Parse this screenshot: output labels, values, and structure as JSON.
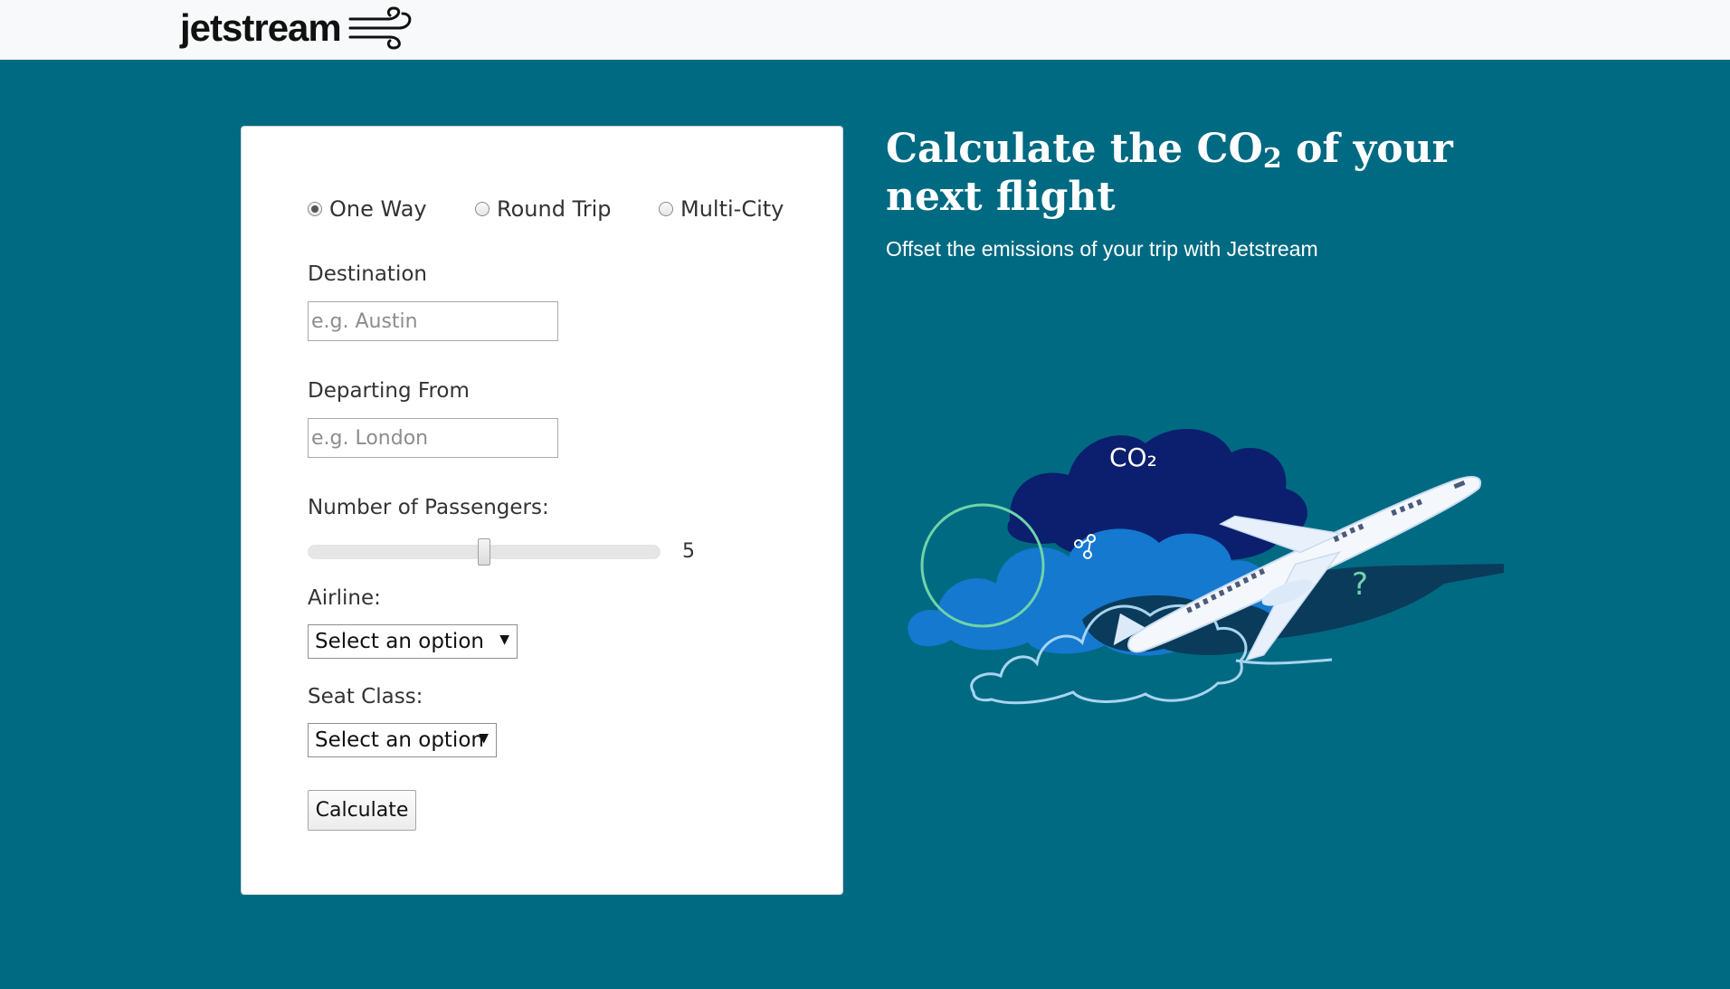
{
  "header": {
    "logo_text": "jetstream",
    "logo_icon": "wind-icon"
  },
  "form": {
    "trip_types": [
      {
        "label": "One Way",
        "checked": true
      },
      {
        "label": "Round Trip",
        "checked": false
      },
      {
        "label": "Multi-City",
        "checked": false
      }
    ],
    "destination": {
      "label": "Destination",
      "placeholder": "e.g. Austin",
      "value": ""
    },
    "departing": {
      "label": "Departing From",
      "placeholder": "e.g. London",
      "value": ""
    },
    "passengers": {
      "label": "Number of Passengers:",
      "value": "5",
      "min": 1,
      "max": 9
    },
    "airline": {
      "label": "Airline:",
      "selected": "Select an option"
    },
    "seat_class": {
      "label": "Seat Class:",
      "selected": "Select an option"
    },
    "calculate_label": "Calculate"
  },
  "hero": {
    "headline_part1": "Calculate the CO",
    "headline_sub": "2",
    "headline_part2": " of your next flight",
    "subtext": "Offset the emissions of your trip with Jetstream",
    "illustration_text": "CO₂",
    "colors": {
      "background": "#006a82",
      "cloud_dark": "#0b1f6e",
      "cloud_mid": "#1479cf",
      "shadow": "#0a3b5a",
      "accent_ring": "#6fd3a8"
    }
  }
}
